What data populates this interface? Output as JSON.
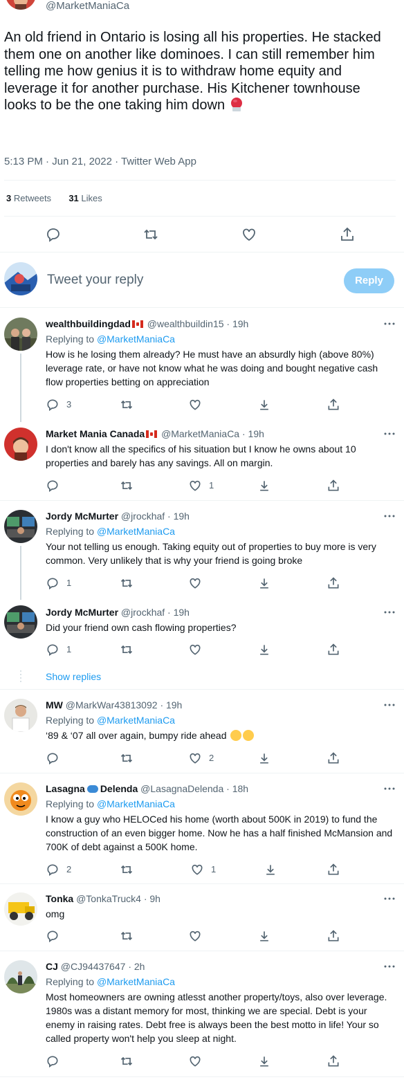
{
  "top_tweet": {
    "handle": "@MarketManiaCa",
    "text": "An old friend in Ontario is losing all his properties. He stacked them one on another like dominoes. I can still remember him telling me how genius it is to withdraw home equity and leverage it for another purchase. His Kitchener townhouse looks to be the one taking him down",
    "meta": "5:13 PM · Jun 21, 2022 · Twitter Web App",
    "retweets_count": "3",
    "retweets_label": "Retweets",
    "likes_count": "31",
    "likes_label": "Likes"
  },
  "composer": {
    "placeholder": "Tweet your reply",
    "button_label": "Reply"
  },
  "show_replies_label": "Show replies",
  "replies": [
    {
      "name": "wealthbuildingdad",
      "handle": "@wealthbuildin15",
      "time": "· 19h",
      "replying_prefix": "Replying to",
      "replying_to": "@MarketManiaCa",
      "text": "How is he losing them already? He must have an absurdly high (above 80%) leverage rate, or have not know what he was doing and bought negative cash flow properties betting on appreciation",
      "reply_count": "3",
      "retweet_count": "",
      "like_count": ""
    },
    {
      "name": "Market Mania Canada",
      "handle": "@MarketManiaCa",
      "time": "· 19h",
      "text": "I don't know all the specifics of his situation but I know he owns about 10 properties and barely has any savings. All on margin.",
      "reply_count": "",
      "retweet_count": "",
      "like_count": "1"
    },
    {
      "name": "Jordy McMurter",
      "handle": "@jrockhaf",
      "time": "· 19h",
      "replying_prefix": "Replying to",
      "replying_to": "@MarketManiaCa",
      "text": "Your not telling us enough. Taking equity out of properties to buy more is very common. Very unlikely that is why your friend is going broke",
      "reply_count": "1",
      "retweet_count": "",
      "like_count": ""
    },
    {
      "name": "Jordy McMurter",
      "handle": "@jrockhaf",
      "time": "· 19h",
      "text": "Did your friend own cash flowing properties?",
      "reply_count": "1",
      "retweet_count": "",
      "like_count": ""
    },
    {
      "name": "MW",
      "handle": "@MarkWar43813092",
      "time": "· 19h",
      "replying_prefix": "Replying to",
      "replying_to": "@MarketManiaCa",
      "text": "‘89 & ‘07 all over again, bumpy ride ahead",
      "reply_count": "",
      "retweet_count": "",
      "like_count": "2"
    },
    {
      "name": "Lasagna",
      "name2": "Delenda",
      "handle": "@LasagnaDelenda",
      "time": "· 18h",
      "replying_prefix": "Replying to",
      "replying_to": "@MarketManiaCa",
      "text": "I know a guy who HELOCed his home (worth about 500K in 2019) to fund the construction of an even bigger home.  Now he has a half finished McMansion and 700K of debt against a 500K home.",
      "reply_count": "2",
      "retweet_count": "",
      "like_count": "1"
    },
    {
      "name": "Tonka",
      "handle": "@TonkaTruck4",
      "time": "· 9h",
      "text": "omg",
      "reply_count": "",
      "retweet_count": "",
      "like_count": ""
    },
    {
      "name": "CJ",
      "handle": "@CJ94437647",
      "time": "· 2h",
      "replying_prefix": "Replying to",
      "replying_to": "@MarketManiaCa",
      "text": "Most homeowners are owning atlesst another property/toys, also over leverage. 1980s was a distant memory for most, thinking we are special. Debt is your enemy in raising rates. Debt free is always been the best motto in life! Your so called property won't help you sleep at night.",
      "reply_count": "",
      "retweet_count": "",
      "like_count": ""
    }
  ],
  "colors": {
    "accent": "#1d9bf0",
    "muted": "#536471",
    "reply_button": "#8ecdf7"
  }
}
